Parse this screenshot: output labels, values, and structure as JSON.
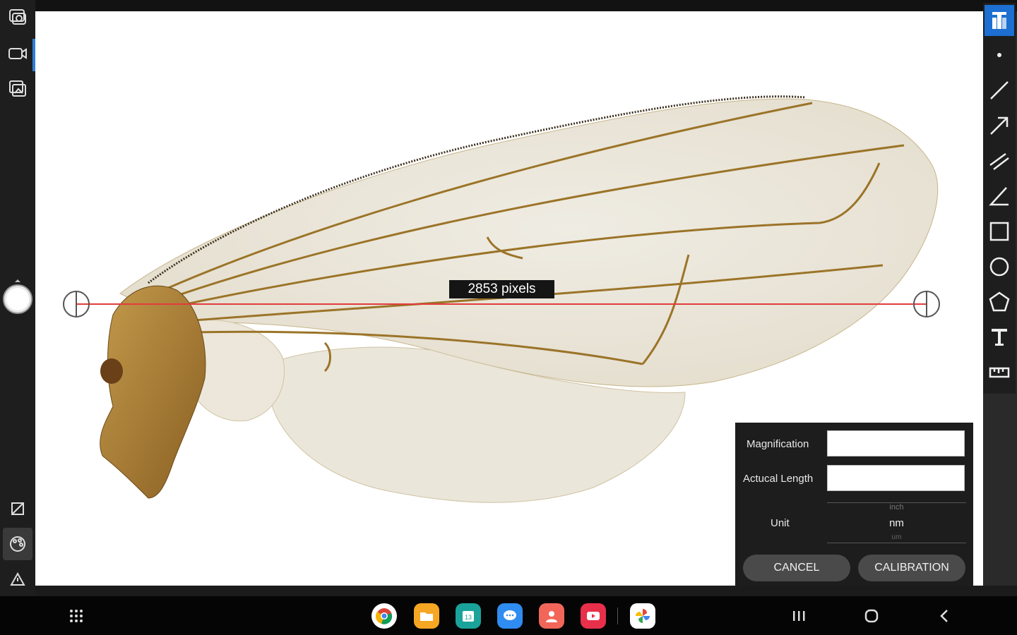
{
  "measurement": {
    "label": "2853 pixels"
  },
  "calibration": {
    "magnification_label": "Magnification",
    "magnification_value": "",
    "actual_length_label": "Actucal Length",
    "actual_length_value": "",
    "unit_label": "Unit",
    "unit_options": [
      "inch",
      "nm",
      "um"
    ],
    "unit_selected": "nm",
    "cancel_label": "CANCEL",
    "calibrate_label": "CALIBRATION"
  },
  "colors": {
    "accent": "#1d6fd1",
    "measure_line": "#e23c3c",
    "panel_bg": "#1d1d1d",
    "button_bg": "#4a4a4a"
  },
  "left_toolbar": {
    "icons": [
      "capture-photo-icon",
      "record-video-icon",
      "gallery-icon",
      "shutter-icon",
      "exposure-icon",
      "color-palette-icon",
      "warning-triangle-icon"
    ]
  },
  "right_toolbar": {
    "icons": [
      "logo-icon",
      "point-icon",
      "line-icon",
      "arrow-icon",
      "parallel-lines-icon",
      "angle-icon",
      "rectangle-icon",
      "circle-icon",
      "polygon-icon",
      "text-icon",
      "ruler-icon"
    ]
  },
  "taskbar": {
    "apps": [
      "chrome-icon",
      "files-icon",
      "calendar-icon",
      "messages-icon",
      "contacts-icon",
      "youtube-icon",
      "photos-icon"
    ],
    "calendar_day": "13",
    "nav": [
      "recents-icon",
      "home-icon",
      "back-icon"
    ]
  }
}
